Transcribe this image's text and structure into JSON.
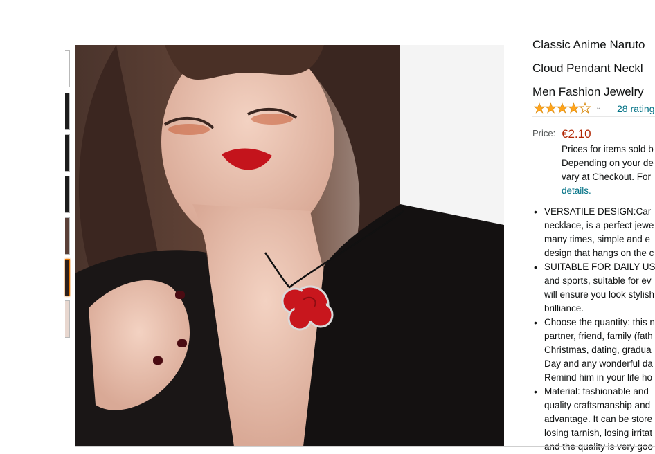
{
  "product": {
    "title_lines": [
      "Classic Anime Naruto",
      "Cloud Pendant Neckl",
      "Men Fashion Jewelry"
    ],
    "rating": {
      "stars_icon": "star-rating-icon",
      "count_label": "28 rating",
      "value": 4.0
    },
    "price": {
      "label": "Price:",
      "value": "€2.10",
      "note_lines": [
        "Prices for items sold b",
        "Depending on your de",
        "vary at Checkout. For"
      ],
      "details_link": "details."
    },
    "bullets": [
      [
        "VERSATILE DESIGN:Car",
        "necklace, is a perfect jewe",
        "many times, simple and e",
        "design that hangs on the c"
      ],
      [
        "SUITABLE FOR DAILY US",
        "and sports, suitable for ev",
        "will ensure you look stylish",
        "brilliance."
      ],
      [
        "Choose the quantity: this n",
        "partner, friend, family (fath",
        "Christmas, dating, gradua",
        "Day and any wonderful da",
        "Remind him in your life ho"
      ],
      [
        "Material: fashionable and",
        "quality craftsmanship and",
        "advantage. It can be store",
        "losing tarnish, losing irritat",
        "and the quality is very goo"
      ]
    ]
  },
  "gallery": {
    "thumbnail_count": 7,
    "active_index": 5,
    "main_image": "woman-wearing-red-cloud-pendant-necklace"
  },
  "colors": {
    "price": "#B12704",
    "link": "#007185",
    "star": "#FFA41C",
    "pendant": "#C8161D"
  }
}
